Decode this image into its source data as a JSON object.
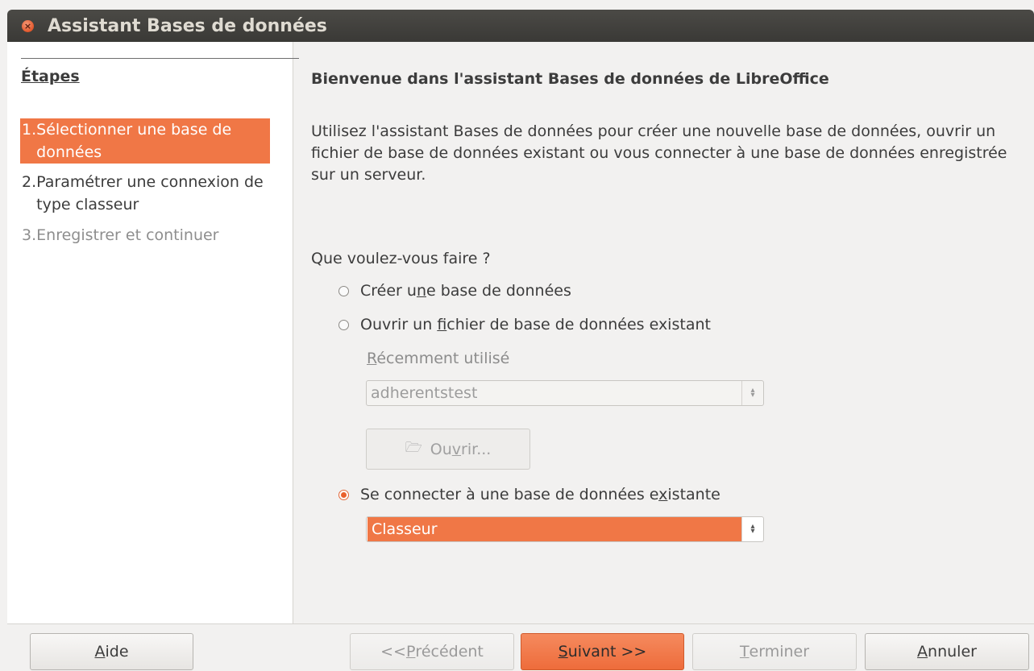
{
  "window": {
    "title": "Assistant Bases de données"
  },
  "sidebar": {
    "heading": "Étapes",
    "steps": [
      {
        "num": "1.",
        "label": "Sélectionner une base de données",
        "state": "active"
      },
      {
        "num": "2.",
        "label": "Paramétrer une connexion de type classeur",
        "state": "normal"
      },
      {
        "num": "3.",
        "label": "Enregistrer et continuer",
        "state": "disabled"
      }
    ]
  },
  "main": {
    "heading": "Bienvenue dans l'assistant Bases de données de LibreOffice",
    "intro": "Utilisez l'assistant Bases de données pour créer une nouvelle base de données, ouvrir un fichier de base de données existant ou vous connecter à une base de données enregistrée sur un serveur.",
    "question": "Que voulez-vous faire ?",
    "options": [
      {
        "pre": "Créer u",
        "mnemonic": "n",
        "post": "e base de données",
        "checked": false
      },
      {
        "pre": "Ouvrir un ",
        "mnemonic": "f",
        "post": "ichier de base de données existant",
        "checked": false
      },
      {
        "pre": "Se connecter à une base de données e",
        "mnemonic": "x",
        "post": "istante",
        "checked": true
      }
    ],
    "recent": {
      "label_mnemonic": "R",
      "label_rest": "écemment utilisé",
      "value": "adherentstest"
    },
    "open_button": {
      "pre": "Ou",
      "mnemonic": "v",
      "post": "rir..."
    },
    "connection_type": {
      "value": "Classeur"
    }
  },
  "footer": {
    "help": {
      "pre": "",
      "mnemonic": "A",
      "post": "ide"
    },
    "back": {
      "pre": "<< ",
      "mnemonic": "P",
      "post": "récédent"
    },
    "next": {
      "pre": "",
      "mnemonic": "S",
      "post": "uivant >>"
    },
    "finish": {
      "pre": "",
      "mnemonic": "T",
      "post": "erminer"
    },
    "cancel": {
      "pre": "",
      "mnemonic": "A",
      "post": "nnuler"
    }
  }
}
